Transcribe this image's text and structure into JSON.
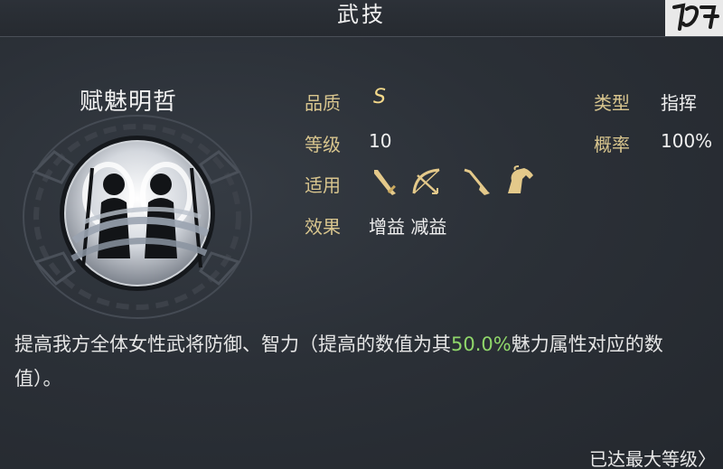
{
  "header": {
    "title": "武技"
  },
  "skill": {
    "name": "赋魅明哲"
  },
  "attributes": {
    "quality_label": "品质",
    "quality_value": "S",
    "level_label": "等级",
    "level_value": "10",
    "applies_label": "适用",
    "effect_label": "效果",
    "effect_value": "增益 减益",
    "type_label": "类型",
    "type_value": "指挥",
    "rate_label": "概率",
    "rate_value": "100%"
  },
  "applies_icons": [
    "sword-icon",
    "bow-icon",
    "spear-icon",
    "horse-icon"
  ],
  "description": {
    "part1": "提高我方全体女性武将防御、智力（提高的数值为其",
    "highlight": "50.0%",
    "part2": "魅力属性对应的数值）。"
  },
  "footer": {
    "status": "已达最大等级〉"
  },
  "colors": {
    "label_gold": "#d8c58e",
    "highlight_green": "#8fd66a",
    "grade_gold": "#f4d98a"
  }
}
